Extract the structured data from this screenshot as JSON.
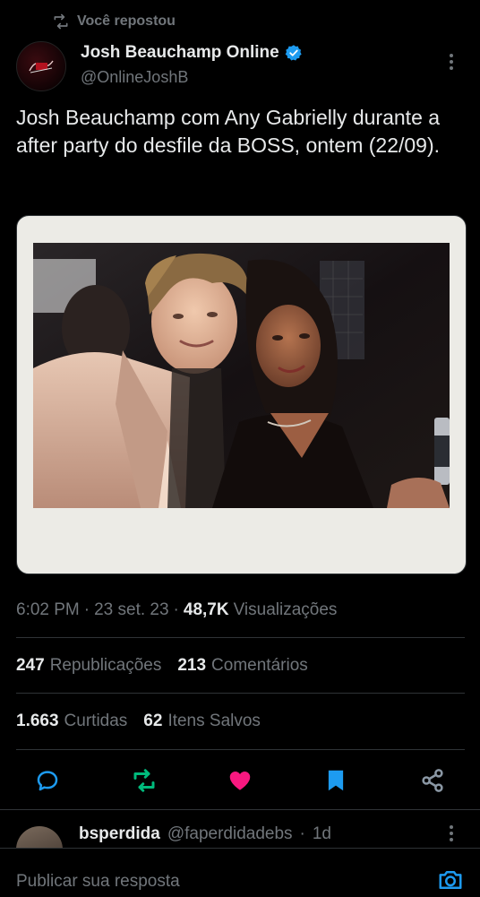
{
  "repost": {
    "label": "Você repostou",
    "icon": "repost-icon"
  },
  "author": {
    "name": "Josh Beauchamp Online",
    "handle": "@OnlineJoshB",
    "verified_color": "#1d9bf0",
    "avatar_icon": "profile-logo"
  },
  "tweet": {
    "text": "Josh Beauchamp com Any Gabrielly durante a after party do desfile da BOSS, ontem (22/09).",
    "image_icon": "photo-polaroid"
  },
  "meta": {
    "time": "6:02 PM",
    "sep1": "·",
    "date": "23 set. 23",
    "sep2": "·",
    "views_count": "48,7K",
    "views_label": "Visualizações"
  },
  "stats": {
    "reposts_count": "247",
    "reposts_label": "Republicações",
    "comments_count": "213",
    "comments_label": "Comentários",
    "likes_count": "1.663",
    "likes_label": "Curtidas",
    "saves_count": "62",
    "saves_label": "Itens Salvos"
  },
  "actions": [
    {
      "icon": "reply-icon",
      "color": "#1d9bf0"
    },
    {
      "icon": "repost-icon",
      "color": "#00ba7c"
    },
    {
      "icon": "heart-icon",
      "color": "#f91880"
    },
    {
      "icon": "bookmark-icon",
      "color": "#1d9bf0"
    },
    {
      "icon": "share-icon",
      "color": "#71767b"
    }
  ],
  "reply": {
    "username": "bsperdida",
    "handle": "@faperdidadebs",
    "sep": "·",
    "age": "1d"
  },
  "composer": {
    "placeholder": "Publicar sua resposta",
    "icon": "camera-icon"
  }
}
